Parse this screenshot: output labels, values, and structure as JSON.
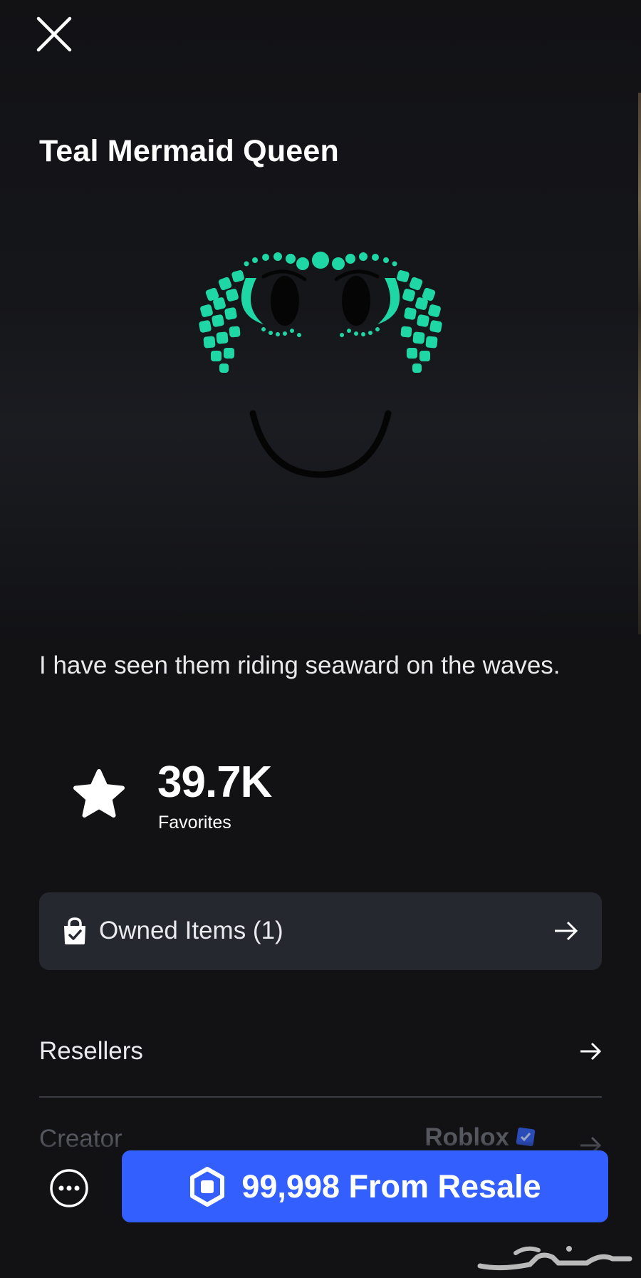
{
  "header": {
    "close_icon": "close-icon"
  },
  "item": {
    "title": "Teal Mermaid Queen",
    "image_description_icon": "mermaid-face-image",
    "description": "I have seen them riding seaward on the waves."
  },
  "stats": {
    "favorites_count": "39.7K",
    "favorites_label": "Favorites",
    "favorites_icon": "star-icon"
  },
  "owned": {
    "label": "Owned Items (1)",
    "icon": "shopping-bag-check-icon",
    "arrow_icon": "arrow-right-icon"
  },
  "resellers": {
    "label": "Resellers",
    "arrow_icon": "arrow-right-icon"
  },
  "creator": {
    "label": "Creator",
    "value": "Roblox",
    "verified_icon": "verified-badge-icon",
    "arrow_icon": "arrow-right-icon"
  },
  "footer": {
    "more_icon": "more-options-icon",
    "buy_label": "99,998 From Resale",
    "buy_icon": "robux-icon"
  },
  "colors": {
    "background": "#121215",
    "panel": "#262830",
    "accent_blue": "#335fff",
    "teal": "#1fd6a5"
  },
  "watermark": {
    "text": "حراج",
    "icon": "haraj-watermark-logo"
  }
}
